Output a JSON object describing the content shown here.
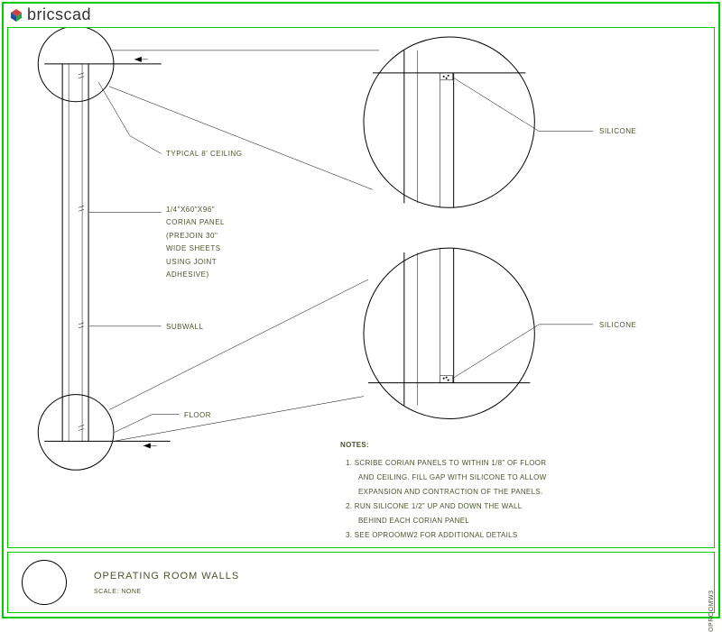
{
  "app": {
    "name_prefix": "brics",
    "name_suffix": "cad"
  },
  "labels": {
    "typical_ceiling": "TYPICAL 8' CEILING",
    "panel_line1": "1/4\"X60\"X96\"",
    "panel_line2": "CORIAN PANEL",
    "panel_line3": "(PREJOIN 30\"",
    "panel_line4": "WIDE SHEETS",
    "panel_line5": "USING JOINT",
    "panel_line6": "ADHESIVE)",
    "subwall": "SUBWALL",
    "floor": "FLOOR",
    "silicone1": "SILICONE",
    "silicone2": "SILICONE"
  },
  "notes": {
    "title": "NOTES:",
    "n1a": "1. SCRIBE CORIAN PANELS TO WITHIN 1/8\" OF FLOOR",
    "n1b": "AND CEILING. FILL GAP WITH SILICONE TO ALLOW",
    "n1c": "EXPANSION AND CONTRACTION OF THE PANELS.",
    "n2a": "2. RUN SILICONE 1/2\" UP AND DOWN THE WALL",
    "n2b": "BEHIND EACH CORIAN PANEL",
    "n3": "3. SEE OPROOMW2 FOR ADDITIONAL DETAILS"
  },
  "title_block": {
    "title": "OPERATING ROOM WALLS",
    "scale": "SCALE: NONE",
    "side_ref": "OPROOMW3"
  }
}
